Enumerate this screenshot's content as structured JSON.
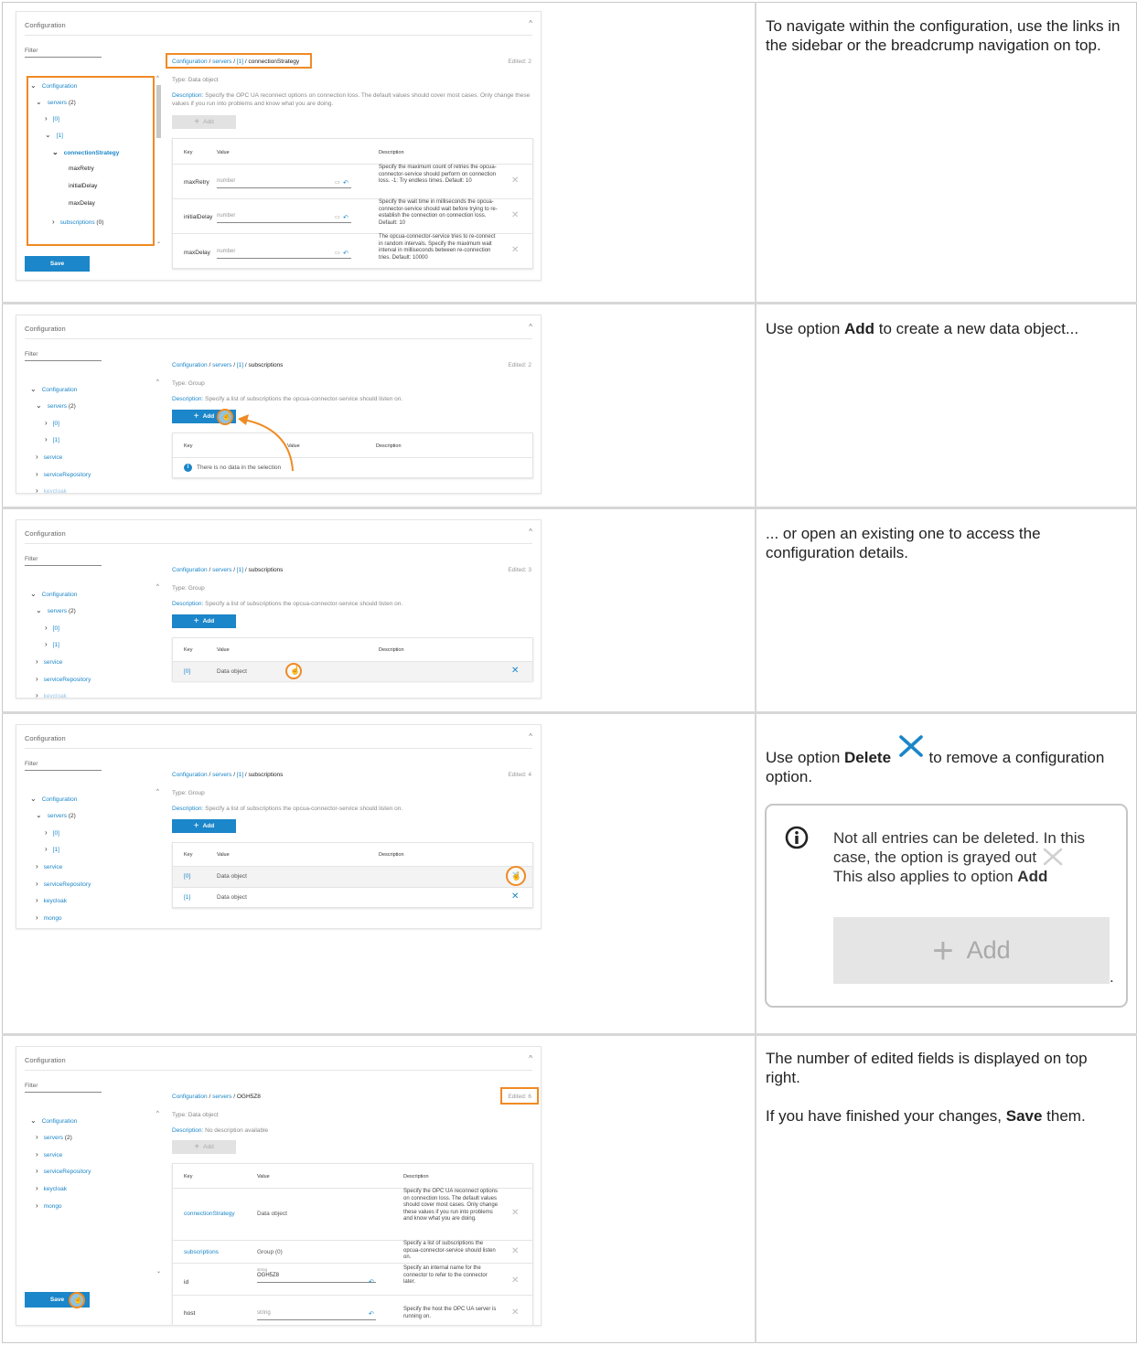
{
  "colors": {
    "accent": "#1b86c9",
    "highlight": "#f08a24",
    "disabled": "#e2e2e2"
  },
  "instructions": {
    "s1": "To navigate within the configuration, use the links in the sidebar or the breadcrump navigation on top.",
    "s2_pre": "Use option ",
    "s2_bold": "Add",
    "s2_post": " to create a new data object...",
    "s3": "... or open an existing one to access the configuration details.",
    "s4_pre": "Use option ",
    "s4_bold": "Delete",
    "s4_post": " to remove a configuration option.",
    "s5_a": "The number of edited fields is displayed on top right.",
    "s5_b_pre": "If you have finished your changes, ",
    "s5_b_bold": "Save",
    "s5_b_post": " them."
  },
  "note": {
    "line1": "Not all entries can be deleted. In this case, the option is grayed out",
    "line2_pre": "This also applies to option ",
    "line2_bold": "Add",
    "add_label": "Add",
    "dot": "."
  },
  "ui": {
    "card_title": "Configuration",
    "filter": "Filter",
    "tree_root": "Configuration",
    "tree_servers": "servers",
    "tree_servers_count": "(2)",
    "tree_0": "[0]",
    "tree_1": "[1]",
    "tree_connectionStrategy": "connectionStrategy",
    "tree_maxRetry": "maxRetry",
    "tree_initialDelay": "initialDelay",
    "tree_maxDelay": "maxDelay",
    "tree_subscriptions": "subscriptions",
    "tree_subscriptions_count": "(0)",
    "tree_service": "service",
    "tree_serviceRepository": "serviceRepository",
    "tree_keycloak": "keycloak",
    "tree_mongo": "mongo",
    "save": "Save",
    "add": "Add",
    "bc_config": "Configuration",
    "bc_servers": "servers",
    "bc_1": "[1]",
    "bc_sep": " / ",
    "bc_connectionStrategy": "connectionStrategy",
    "bc_subscriptions": "subscriptions",
    "bc_ogh": "OGH5Z8",
    "edited_2": "Edited: 2",
    "edited_3": "Edited: 3",
    "edited_4": "Edited: 4",
    "edited_6": "Edited: 6",
    "type_label": "Type:",
    "type_data_object": " Data object",
    "type_group": " Group",
    "desc_label": "Description:",
    "desc_cs": " Specify the OPC UA reconnect options on connection loss. The default values should cover most cases. Only change these values if you run into problems and know what you are doing.",
    "desc_subs": " Specify a list of subscriptions the opcua-connector-service should listen on.",
    "desc_none": " No description available",
    "col_key": "Key",
    "col_value": "Value",
    "col_desc": "Description",
    "row_maxRetry": "maxRetry",
    "row_initialDelay": "initialDelay",
    "row_maxDelay": "maxDelay",
    "ph_number": "number",
    "d_maxRetry": "Specify the maximum count of retries the opcua-connector-service should perform on connection loss. -1: Try endless times. Default: 10",
    "d_initialDelay": "Specify the wait time in milliseconds the opcua-connector-service should wait before trying to re-establish the connection on connection loss. Default: 10",
    "d_maxDelay": "The opcua-connector-service tries to re-connect in random intervals. Specify the maximum wait interval in milliseconds between re-connection tries. Default: 10000",
    "no_data": "There is no data in the selection",
    "row_0": "[0]",
    "row_1": "[1]",
    "data_object": "Data object",
    "row_connectionStrategy": "connectionStrategy",
    "row_subscriptions": "subscriptions",
    "val_group0": "Group (0)",
    "row_id": "id",
    "row_host": "host",
    "val_string_small": "string",
    "val_ogh": "OGH5Z8",
    "ph_string": "string",
    "d_cs": "Specify the OPC UA reconnect options on connection loss. The default values should cover most cases. Only change these values if you run into problems and know what you are doing.",
    "d_subs": "Specify a list of subscriptions the opcua-connector-service should listen on.",
    "d_id": "Specify an internal name for the connector to refer to the connector later.",
    "d_host": "Specify the host the OPC UA server is running on."
  }
}
